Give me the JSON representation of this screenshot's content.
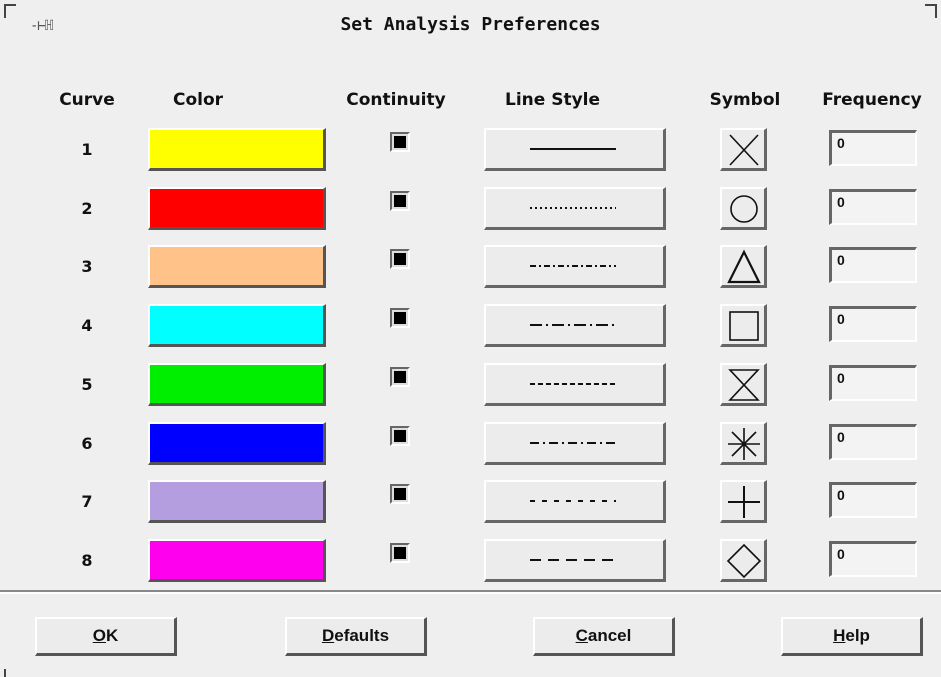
{
  "window": {
    "title": "Set Analysis Preferences",
    "menu_icon": "window-menu-icon"
  },
  "headers": {
    "curve": "Curve",
    "color": "Color",
    "continuity": "Continuity",
    "line_style": "Line Style",
    "symbol": "Symbol",
    "frequency": "Frequency"
  },
  "rows": [
    {
      "curve": "1",
      "color": "#ffff00",
      "continuity": true,
      "line_style": "solid",
      "symbol": "x-symbol",
      "frequency": "0"
    },
    {
      "curve": "2",
      "color": "#ff0000",
      "continuity": true,
      "line_style": "dotted",
      "symbol": "circle-symbol",
      "frequency": "0"
    },
    {
      "curve": "3",
      "color": "#ffc38a",
      "continuity": true,
      "line_style": "dash-dot",
      "symbol": "triangle-symbol",
      "frequency": "0"
    },
    {
      "curve": "4",
      "color": "#00ffff",
      "continuity": true,
      "line_style": "long-dash-dot",
      "symbol": "square-symbol",
      "frequency": "0"
    },
    {
      "curve": "5",
      "color": "#00ee00",
      "continuity": true,
      "line_style": "short-dash",
      "symbol": "hourglass-symbol",
      "frequency": "0"
    },
    {
      "curve": "6",
      "color": "#0000ff",
      "continuity": true,
      "line_style": "medium-dash-dot",
      "symbol": "asterisk-symbol",
      "frequency": "0"
    },
    {
      "curve": "7",
      "color": "#b59ee0",
      "continuity": true,
      "line_style": "spaced-dash-dot",
      "symbol": "plus-symbol",
      "frequency": "0"
    },
    {
      "curve": "8",
      "color": "#ff00ee",
      "continuity": true,
      "line_style": "long-dash",
      "symbol": "diamond-symbol",
      "frequency": "0"
    }
  ],
  "buttons": {
    "ok": {
      "mnemonic": "O",
      "rest": "K"
    },
    "defaults": {
      "mnemonic": "D",
      "rest": "efaults"
    },
    "cancel": {
      "mnemonic": "C",
      "rest": "ancel"
    },
    "help": {
      "mnemonic": "H",
      "rest": "elp"
    }
  }
}
